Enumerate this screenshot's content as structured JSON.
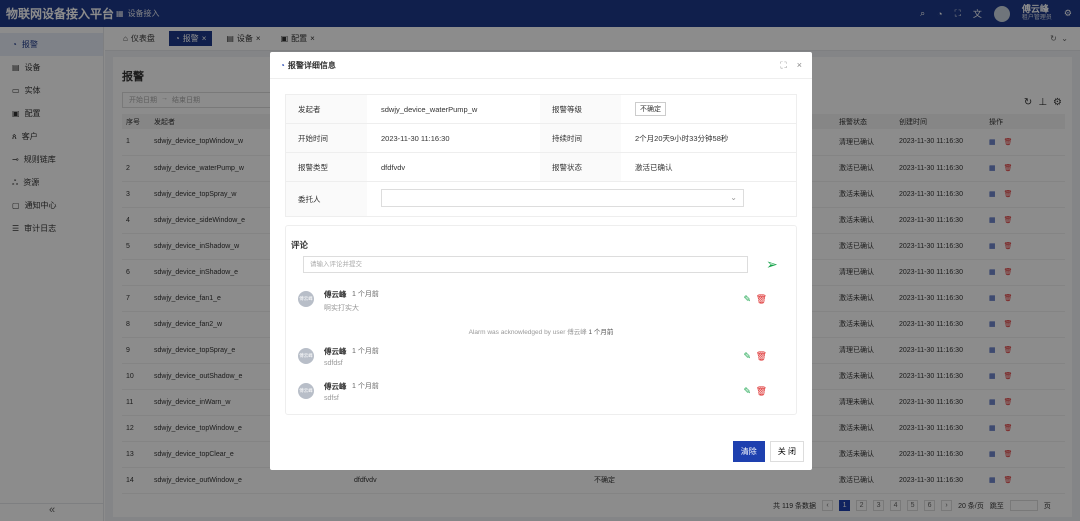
{
  "app": {
    "brand": "物联网设备接入平台",
    "system": "设备接入"
  },
  "topbar": {
    "user_name": "傅云峰",
    "user_role": "租户管理员"
  },
  "sidebar": {
    "items": [
      {
        "label": "报警",
        "active": true
      },
      {
        "label": "设备"
      },
      {
        "label": "实体"
      },
      {
        "label": "配置"
      },
      {
        "label": "客户"
      },
      {
        "label": "规则链库"
      },
      {
        "label": "资源"
      },
      {
        "label": "通知中心"
      },
      {
        "label": "审计日志"
      }
    ],
    "collapse": "«"
  },
  "tabs": [
    {
      "label": "仪表盘"
    },
    {
      "label": "报警",
      "active": true
    },
    {
      "label": "设备"
    },
    {
      "label": "配置"
    }
  ],
  "page": {
    "title": "报警",
    "filter_start": "开始日期",
    "filter_arrow": "→",
    "filter_end": "结束日期",
    "columns": [
      "序号",
      "发起者",
      "",
      "",
      "报警状态",
      "创建时间",
      "操作"
    ],
    "rows": [
      {
        "no": "1",
        "origin": "sdwjy_device_topWindow_w",
        "status": "清理已确认",
        "created": "2023-11-30 11:16:30"
      },
      {
        "no": "2",
        "origin": "sdwjy_device_waterPump_w",
        "status": "激活已确认",
        "created": "2023-11-30 11:16:30"
      },
      {
        "no": "3",
        "origin": "sdwjy_device_topSpray_w",
        "status": "激活未确认",
        "created": "2023-11-30 11:16:30"
      },
      {
        "no": "4",
        "origin": "sdwjy_device_sideWindow_e",
        "status": "激活未确认",
        "created": "2023-11-30 11:16:30"
      },
      {
        "no": "5",
        "origin": "sdwjy_device_inShadow_w",
        "status": "激活已确认",
        "created": "2023-11-30 11:16:30"
      },
      {
        "no": "6",
        "origin": "sdwjy_device_inShadow_e",
        "status": "清理已确认",
        "created": "2023-11-30 11:16:30"
      },
      {
        "no": "7",
        "origin": "sdwjy_device_fan1_e",
        "status": "激活未确认",
        "created": "2023-11-30 11:16:30"
      },
      {
        "no": "8",
        "origin": "sdwjy_device_fan2_w",
        "status": "激活未确认",
        "created": "2023-11-30 11:16:30"
      },
      {
        "no": "9",
        "origin": "sdwjy_device_topSpray_e",
        "status": "清理已确认",
        "created": "2023-11-30 11:16:30"
      },
      {
        "no": "10",
        "origin": "sdwjy_device_outShadow_e",
        "status": "激活未确认",
        "created": "2023-11-30 11:16:30"
      },
      {
        "no": "11",
        "origin": "sdwjy_device_inWarn_w",
        "status": "清理未确认",
        "created": "2023-11-30 11:16:30"
      },
      {
        "no": "12",
        "origin": "sdwjy_device_topWindow_e",
        "status": "激活未确认",
        "created": "2023-11-30 11:16:30"
      },
      {
        "no": "13",
        "origin": "sdwjy_device_topClear_e",
        "status": "激活未确认",
        "created": "2023-11-30 11:16:30"
      },
      {
        "no": "14",
        "origin": "sdwjy_device_outWindow_e",
        "type": "dfdfvdv",
        "level": "不确定",
        "status": "激活已确认",
        "created": "2023-11-30 11:16:30"
      }
    ],
    "pager": {
      "total": "共 119 条数据",
      "pages": [
        "1",
        "2",
        "3",
        "4",
        "5",
        "6"
      ],
      "size": "20 条/页",
      "goto": "跳至",
      "page_unit": "页"
    }
  },
  "dialog": {
    "title": "报警详细信息",
    "fields": {
      "originator_label": "发起者",
      "originator": "sdwjy_device_waterPump_w",
      "severity_label": "报警等级",
      "severity": "不确定",
      "start_label": "开始时间",
      "start": "2023-11-30 11:16:30",
      "duration_label": "持续时间",
      "duration": "2个月20天9小时33分钟58秒",
      "type_label": "报警类型",
      "type": "dfdfvdv",
      "status_label": "报警状态",
      "status": "激活已确认",
      "assignee_label": "委托人"
    },
    "comments_title": "评论",
    "comment_placeholder": "请输入评论并提交",
    "comments": [
      {
        "avatar": "傅云峰",
        "name": "傅云峰",
        "time": "1 个月前",
        "text": "啊实打实大"
      },
      {
        "avatar": "傅云峰",
        "name": "傅云峰",
        "time": "1 个月前",
        "text": "sdfdsf"
      },
      {
        "avatar": "傅云峰",
        "name": "傅云峰",
        "time": "1 个月前",
        "text": "sdfsf"
      }
    ],
    "ack": {
      "text": "Alarm was acknowledged by user 傅云峰",
      "time": "1 个月前"
    },
    "clear_button": "清除",
    "close_button": "关 闭"
  }
}
